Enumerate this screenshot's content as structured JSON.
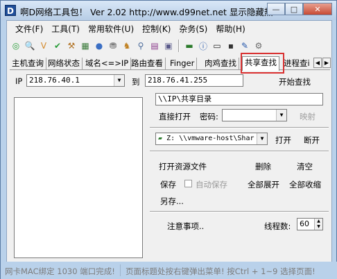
{
  "window": {
    "app_icon_letter": "D",
    "title": "啊D网络工具包！ Ver 2.02   http://www.d99net.net  显示隐藏热..."
  },
  "window_buttons": {
    "minimize": "—",
    "maximize": "□",
    "close": "✕"
  },
  "menu": [
    "文件(F)",
    "工具(T)",
    "常用软件(U)",
    "控制(K)",
    "杂务(S)",
    "帮助(H)"
  ],
  "toolbar_icons": [
    {
      "name": "scan-icon",
      "glyph": "◎",
      "color": "#2a9d3a"
    },
    {
      "name": "search-icon",
      "glyph": "🔍",
      "color": "#2255aa"
    },
    {
      "name": "v-icon",
      "glyph": "V",
      "color": "#d4892a"
    },
    {
      "name": "check-icon",
      "glyph": "✔",
      "color": "#2a9d3a"
    },
    {
      "name": "tool-icon",
      "glyph": "⚒",
      "color": "#b07020"
    },
    {
      "name": "chart-icon",
      "glyph": "▦",
      "color": "#3a7a3a"
    },
    {
      "name": "globe-icon",
      "glyph": "●",
      "color": "#3b6fc4"
    },
    {
      "name": "network-icon",
      "glyph": "⛃",
      "color": "#555"
    },
    {
      "name": "user-icon",
      "glyph": "♞",
      "color": "#c08020"
    },
    {
      "name": "search-person-icon",
      "glyph": "⚲",
      "color": "#4a6a9a"
    },
    {
      "name": "grid-icon",
      "glyph": "▤",
      "color": "#8a3a8a"
    },
    {
      "name": "window-icon",
      "glyph": "▣",
      "color": "#5a5a8a"
    },
    {
      "name": "monitor-icon",
      "glyph": "▬",
      "color": "#2a7a2a"
    },
    {
      "name": "info-icon",
      "glyph": "ⓘ",
      "color": "#2255aa"
    },
    {
      "name": "terminal-icon",
      "glyph": "▭",
      "color": "#222"
    },
    {
      "name": "computer-icon",
      "glyph": "▪",
      "color": "#333"
    },
    {
      "name": "pen-icon",
      "glyph": "✎",
      "color": "#2255aa"
    },
    {
      "name": "gear-icon",
      "glyph": "⚙",
      "color": "#6a6a6a"
    }
  ],
  "tabs": [
    "主机查询",
    "网络状态",
    "域名<=>IP",
    "路由查看",
    "Finger",
    "肉鸡查找",
    "共享查找",
    "进程查i"
  ],
  "active_tab": "共享查找",
  "ip_range": {
    "ip_label": "IP",
    "start_ip": "218.76.40.1",
    "to_label": "到",
    "end_ip": "218.76.41.255",
    "start_button": "开始查找"
  },
  "share_path": "\\\\IP\\共享目录",
  "direct_open": {
    "direct_open_label": "直接打开",
    "password_label": "密码:",
    "password_value": "",
    "map_button": "映射"
  },
  "mapped_drive": {
    "drive_value": "Z:  \\\\vmware-host\\Shar",
    "open_button": "打开",
    "disconnect_button": "断开"
  },
  "actions": {
    "open_explorer": "打开资源文件",
    "delete": "删除",
    "clear": "清空",
    "save": "保存",
    "auto_save": "自动保存",
    "expand_all": "全部展开",
    "collapse_all": "全部收缩",
    "save_as": "另存..."
  },
  "footer_row": {
    "notes": "注意事项..",
    "threads_label": "线程数:",
    "threads_value": "60"
  },
  "status": {
    "left": "网卡MAC绑定 1030 端口完成!",
    "right": "页面标题处按右键弹出菜单! 按Ctrl + 1~9  选择页面!"
  }
}
